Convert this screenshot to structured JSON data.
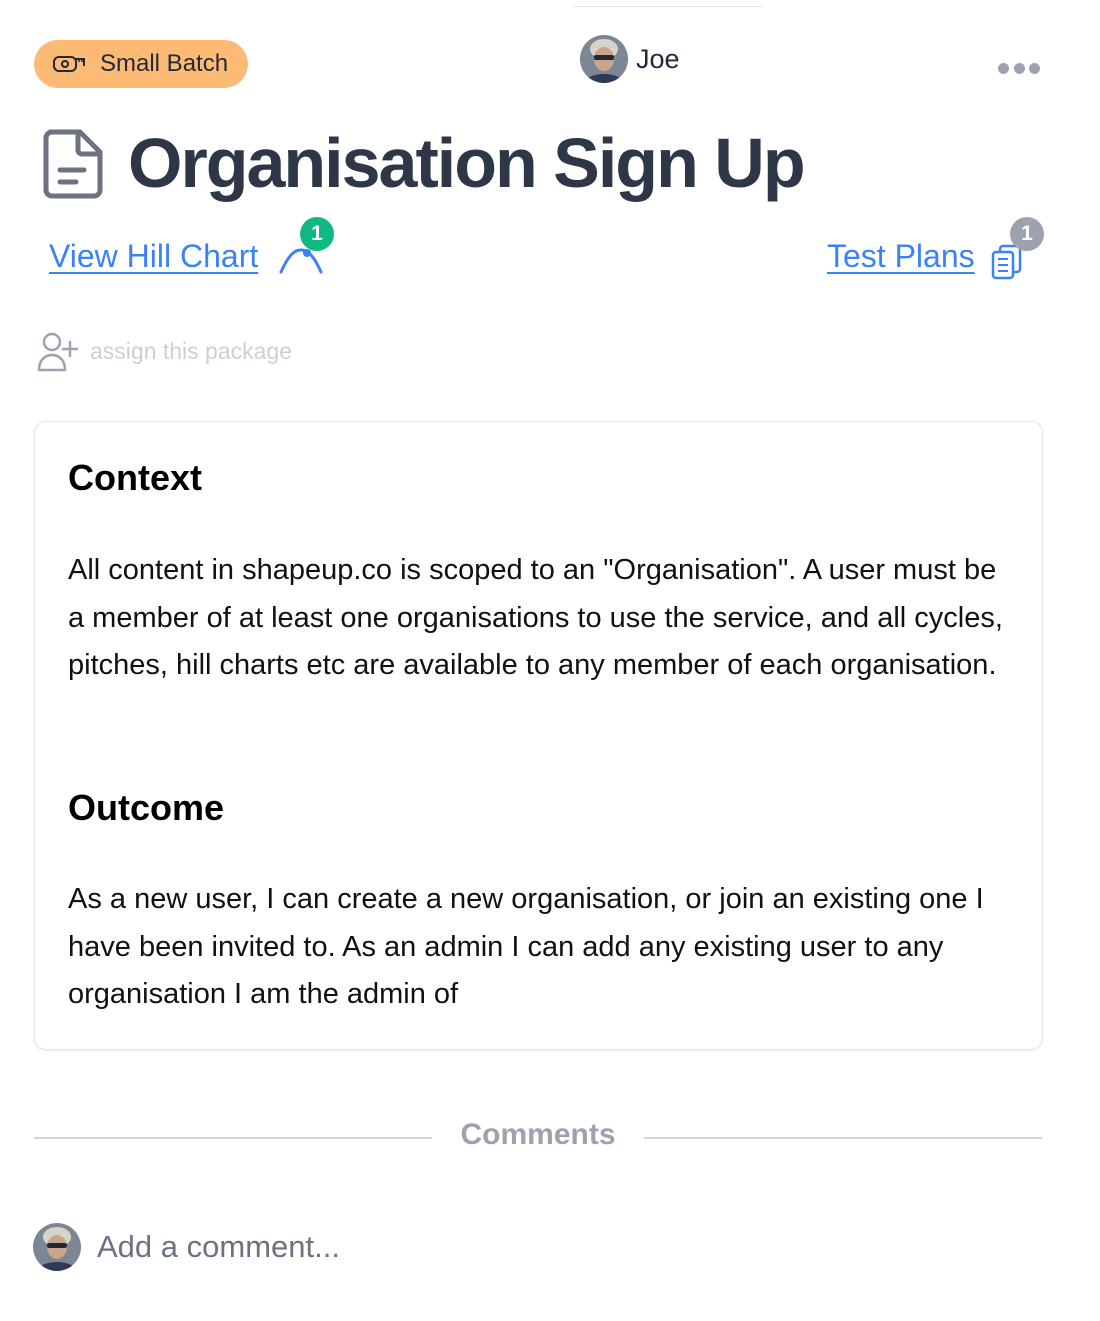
{
  "header": {
    "badge": {
      "label": "Small Batch",
      "icon": "tape-measure-icon",
      "color": "#fdba74"
    },
    "owner": {
      "name": "Joe",
      "avatar": "user-avatar"
    },
    "more_icon": "more-dots-icon"
  },
  "title": {
    "text": "Organisation Sign Up",
    "icon": "document-icon",
    "color": "#2d3748"
  },
  "links": {
    "hill_chart": {
      "label": "View Hill Chart",
      "icon": "hill-chart-icon",
      "count": "1",
      "count_color": "#10b981"
    },
    "test_plans": {
      "label": "Test Plans",
      "icon": "clipboard-icon",
      "count": "1",
      "count_color": "#9ca3af"
    },
    "link_color": "#3b82f6"
  },
  "assign": {
    "label": "assign this package",
    "icon": "add-user-icon"
  },
  "content": {
    "context_heading": "Context",
    "context_body": "All content in shapeup.co is scoped to an \"Organisation\". A user must be a member of at least one organisations to use the service, and all cycles, pitches, hill charts etc are available to any member of each organisation.",
    "outcome_heading": "Outcome",
    "outcome_body": "As a new user, I can create a new organisation, or join an existing one I have been invited to. As an admin I can add any existing user to any organisation I am the admin of"
  },
  "comments": {
    "title": "Comments",
    "placeholder": "Add a comment..."
  }
}
